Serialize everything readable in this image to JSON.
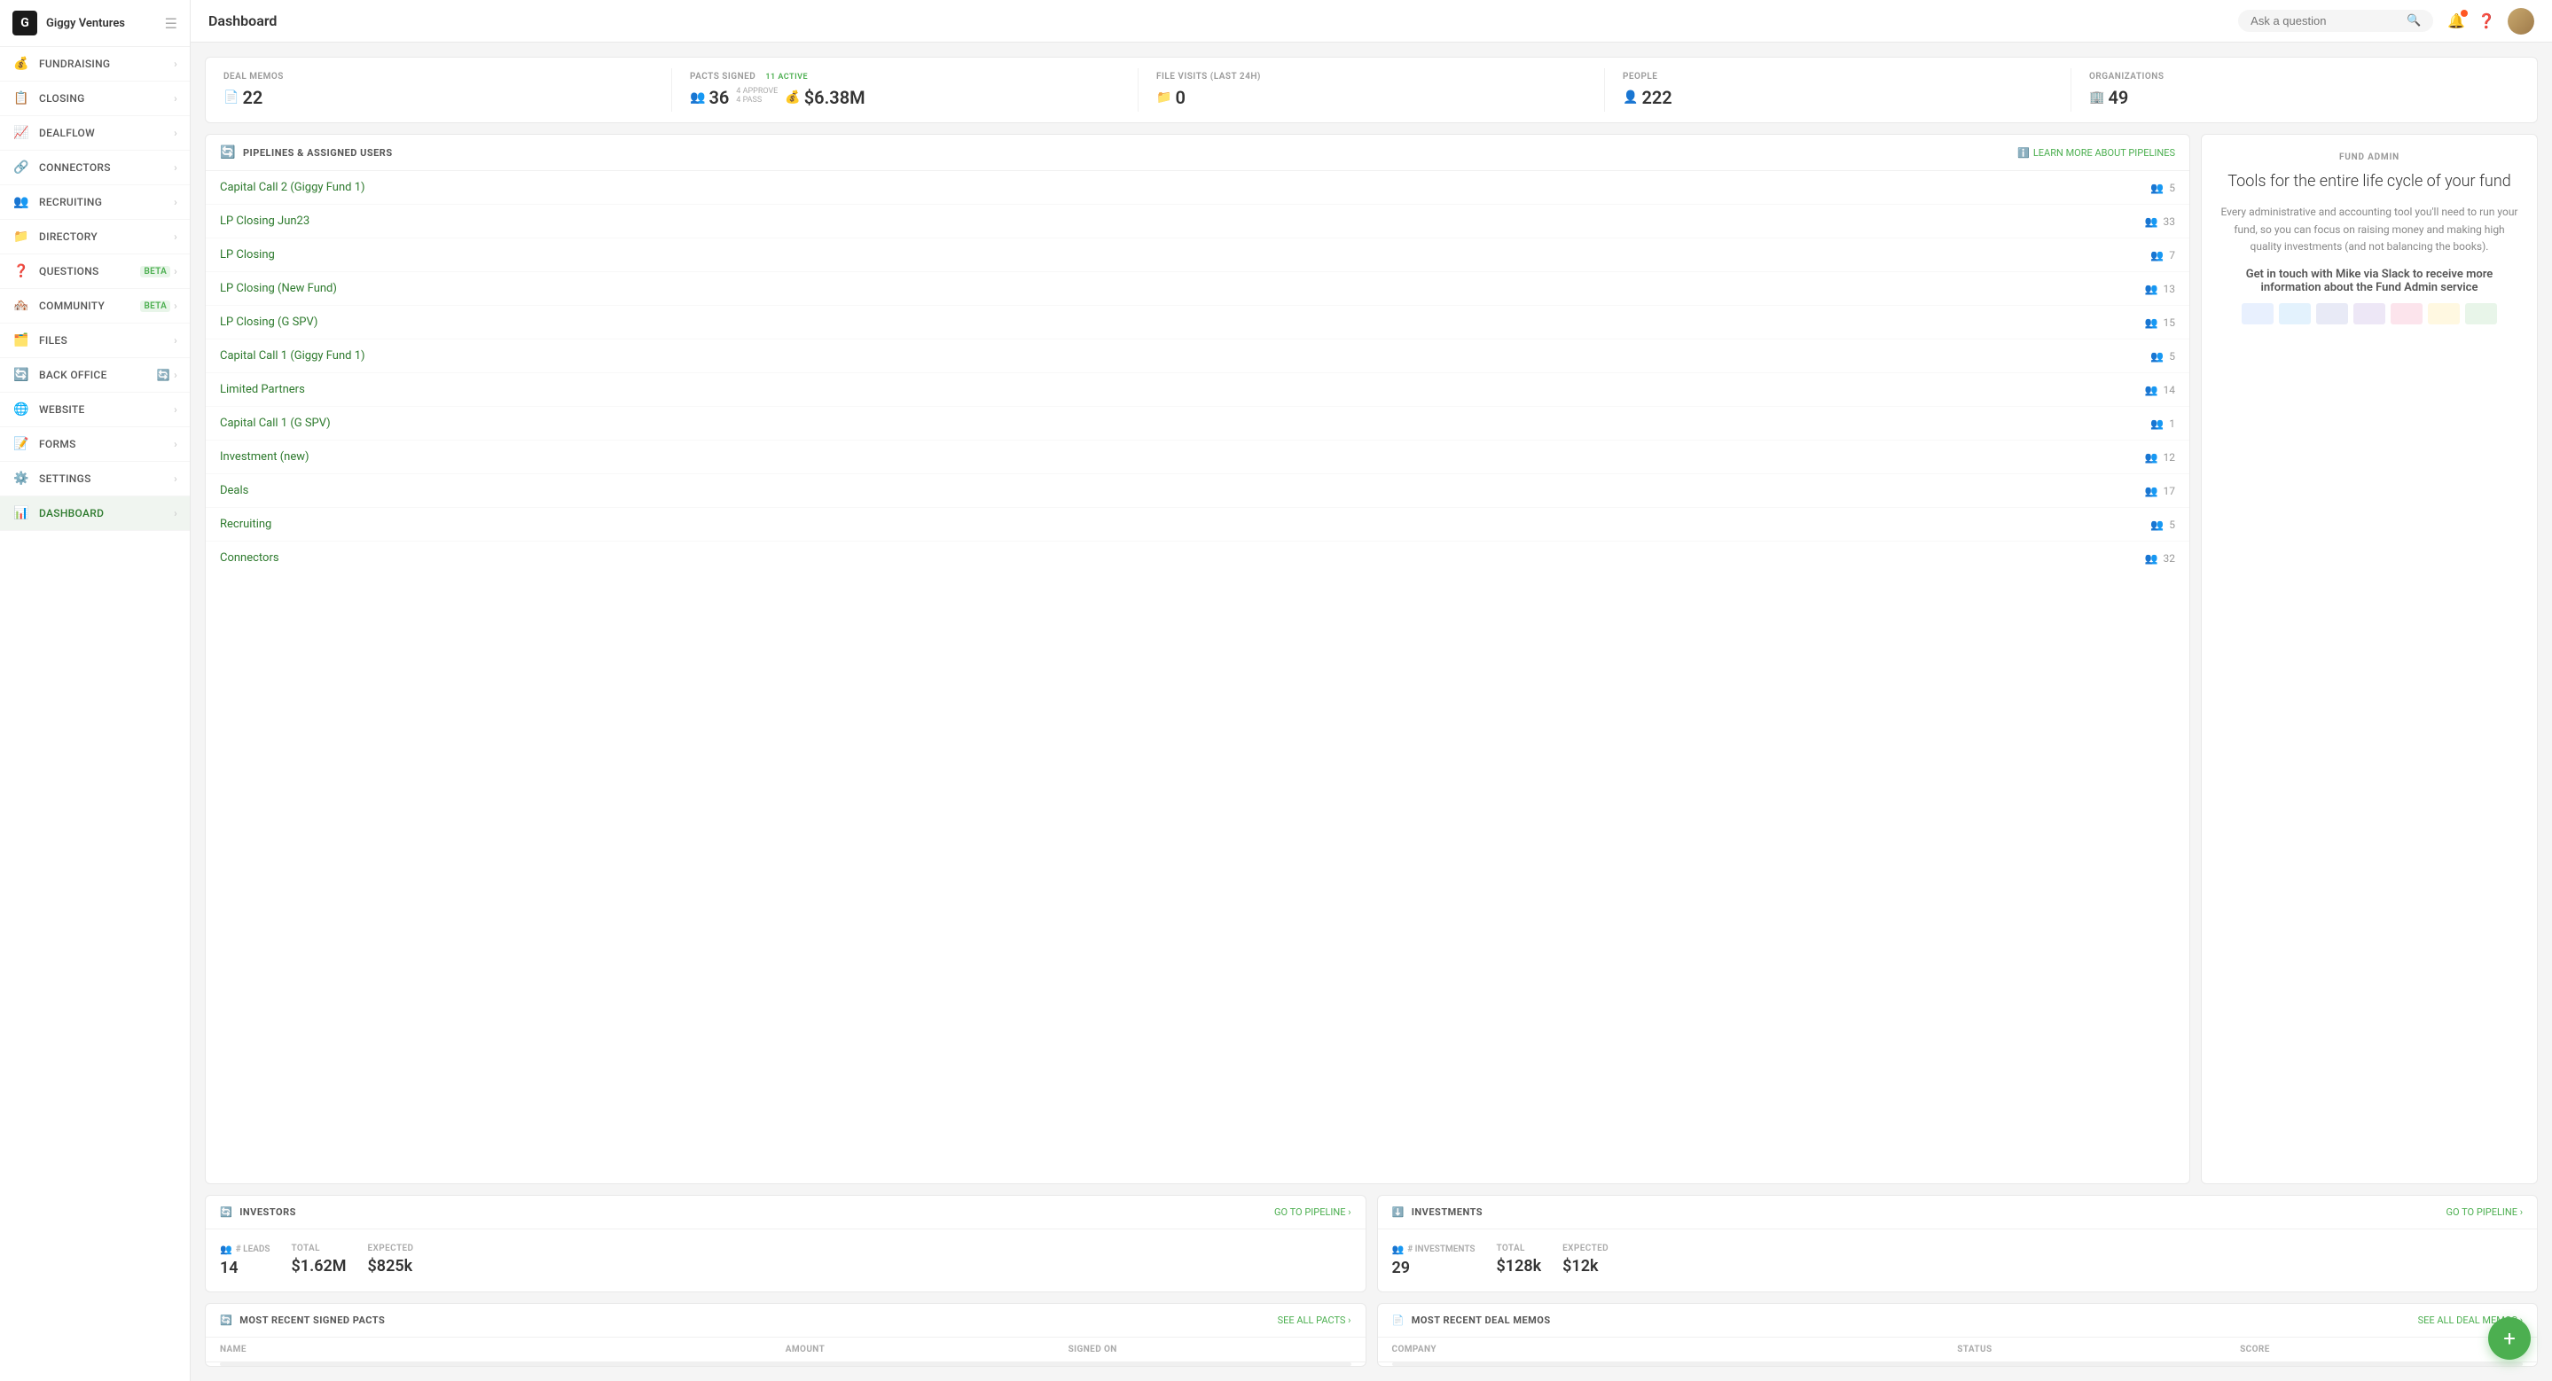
{
  "app": {
    "company": "Giggy Ventures",
    "logo_letter": "G"
  },
  "topbar": {
    "title": "Dashboard",
    "search_placeholder": "Ask a question"
  },
  "sidebar": {
    "items": [
      {
        "id": "fundraising",
        "label": "FUNDRAISING",
        "icon": "💰",
        "active": false,
        "badge": null
      },
      {
        "id": "closing",
        "label": "CLOSING",
        "icon": "📋",
        "active": false,
        "badge": null
      },
      {
        "id": "dealflow",
        "label": "DEALFLOW",
        "icon": "📈",
        "active": false,
        "badge": null
      },
      {
        "id": "connectors",
        "label": "CONNECTORS",
        "icon": "🔗",
        "active": false,
        "badge": null
      },
      {
        "id": "recruiting",
        "label": "RECRUITING",
        "icon": "👥",
        "active": false,
        "badge": null
      },
      {
        "id": "directory",
        "label": "DIRECTORY",
        "icon": "📁",
        "active": false,
        "badge": null
      },
      {
        "id": "questions",
        "label": "QUESTIONS",
        "icon": "❓",
        "active": false,
        "badge": "BETA"
      },
      {
        "id": "community",
        "label": "COMMUNITY",
        "icon": "🏘️",
        "active": false,
        "badge": "BETA"
      },
      {
        "id": "files",
        "label": "FILES",
        "icon": "🗂️",
        "active": false,
        "badge": null
      },
      {
        "id": "back-office",
        "label": "BACK OFFICE",
        "icon": "🔄",
        "active": false,
        "badge": null
      },
      {
        "id": "website",
        "label": "WEBSITE",
        "icon": "🌐",
        "active": false,
        "badge": null
      },
      {
        "id": "forms",
        "label": "FORMS",
        "icon": "📝",
        "active": false,
        "badge": null
      },
      {
        "id": "settings",
        "label": "SETTINGS",
        "icon": "⚙️",
        "active": false,
        "badge": null
      },
      {
        "id": "dashboard",
        "label": "DASHBOARD",
        "icon": "📊",
        "active": true,
        "badge": null
      }
    ]
  },
  "stats": {
    "deal_memos": {
      "label": "DEAL MEMOS",
      "value": "22",
      "icon": "📄"
    },
    "pacts_signed": {
      "label": "PACTS SIGNED",
      "value": "36",
      "amount": "$6.38M",
      "active": "11 ACTIVE",
      "approve": "4 APPROVE",
      "pass": "4 PASS"
    },
    "file_visits": {
      "label": "FILE VISITS (last 24h)",
      "value": "0",
      "icon": "📁"
    },
    "people": {
      "label": "PEOPLE",
      "value": "222",
      "icon": "👤"
    },
    "organizations": {
      "label": "ORGANIZATIONS",
      "value": "49",
      "icon": "🏢"
    }
  },
  "pipelines": {
    "section_label": "PIPELINES & ASSIGNED USERS",
    "learn_more": "LEARN MORE ABOUT PIPELINES",
    "items": [
      {
        "name": "Capital Call 2 (Giggy Fund 1)",
        "count": 5
      },
      {
        "name": "LP Closing Jun23",
        "count": 33
      },
      {
        "name": "LP Closing",
        "count": 7
      },
      {
        "name": "LP Closing (New Fund)",
        "count": 13
      },
      {
        "name": "LP Closing (G SPV)",
        "count": 15
      },
      {
        "name": "Capital Call 1 (Giggy Fund 1)",
        "count": 5
      },
      {
        "name": "Limited Partners",
        "count": 14
      },
      {
        "name": "Capital Call 1 (G SPV)",
        "count": 1
      },
      {
        "name": "Investment (new)",
        "count": 12
      },
      {
        "name": "Deals",
        "count": 17
      },
      {
        "name": "Recruiting",
        "count": 5
      },
      {
        "name": "Connectors",
        "count": 32
      }
    ]
  },
  "fund_admin": {
    "label": "FUND ADMIN",
    "title": "Tools for the entire life cycle of your fund",
    "description": "Every administrative and accounting tool you'll need to run your fund, so you can focus on raising money and making high quality investments (and not balancing the books).",
    "highlight": "Get in touch with Mike via Slack to receive more information about the Fund Admin service"
  },
  "investors": {
    "label": "INVESTORS",
    "go_to_pipeline": "GO TO PIPELINE ›",
    "leads_label": "# LEADS",
    "leads_value": "14",
    "total_label": "TOTAL",
    "total_value": "$1.62M",
    "expected_label": "EXPECTED",
    "expected_value": "$825k"
  },
  "investments": {
    "label": "INVESTMENTS",
    "go_to_pipeline": "GO TO PIPELINE ›",
    "count_label": "# INVESTMENTS",
    "count_value": "29",
    "total_label": "TOTAL",
    "total_value": "$128k",
    "expected_label": "EXPECTED",
    "expected_value": "$12k"
  },
  "signed_pacts": {
    "label": "MOST RECENT SIGNED PACTS",
    "see_all": "SEE ALL PACTS ›",
    "columns": [
      "NAME",
      "AMOUNT",
      "SIGNED ON"
    ]
  },
  "deal_memos_section": {
    "label": "MOST RECENT DEAL MEMOS",
    "see_all": "SEE ALL DEAL MEMOS ›",
    "columns": [
      "COMPANY",
      "STATUS",
      "SCORE"
    ]
  },
  "fab": {
    "label": "+"
  }
}
